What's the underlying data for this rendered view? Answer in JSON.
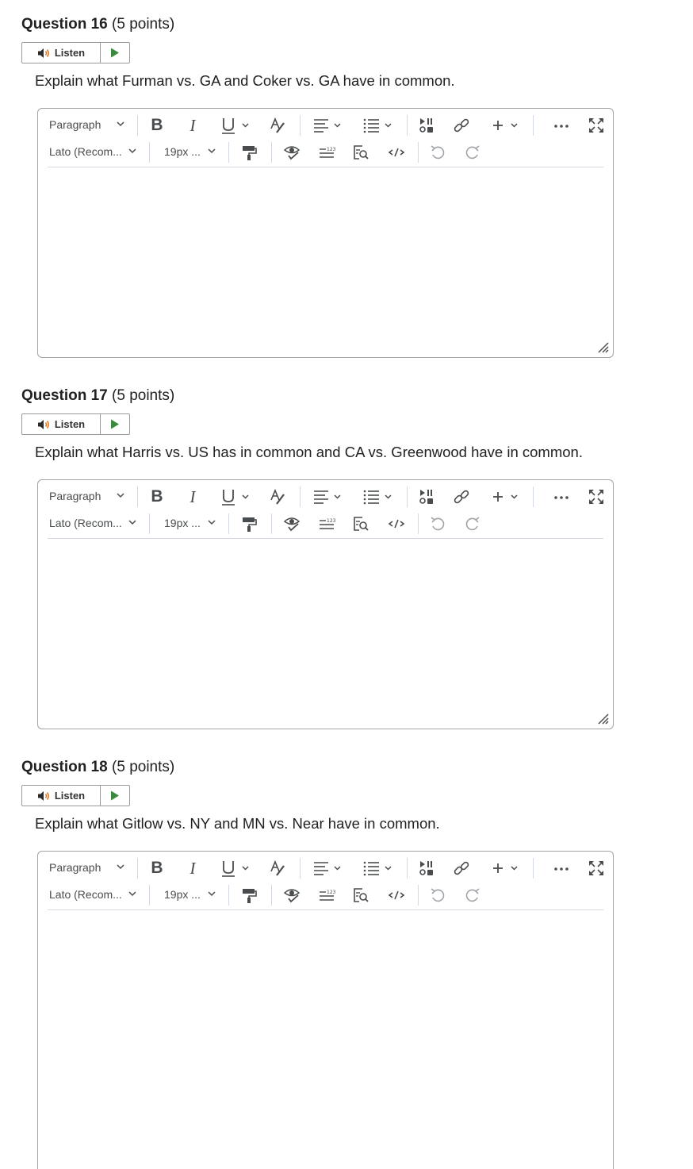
{
  "questions": [
    {
      "number": "Question 16",
      "points": "(5 points)",
      "listen_label": "Listen",
      "text": "Explain what Furman vs. GA and Coker vs. GA have in common."
    },
    {
      "number": "Question 17",
      "points": "(5 points)",
      "listen_label": "Listen",
      "text": "Explain what Harris vs. US has in common and CA vs. Greenwood have in common."
    },
    {
      "number": "Question 18",
      "points": "(5 points)",
      "listen_label": "Listen",
      "text": "Explain what Gitlow vs. NY and MN vs. Near have in common."
    }
  ],
  "toolbar": {
    "block_format": "Paragraph",
    "font_family": "Lato (Recom...",
    "font_size": "19px ..."
  },
  "colors": {
    "play_green": "#3a8a3e",
    "speaker_orange": "#e07a2e",
    "border": "#a3a3a3"
  }
}
